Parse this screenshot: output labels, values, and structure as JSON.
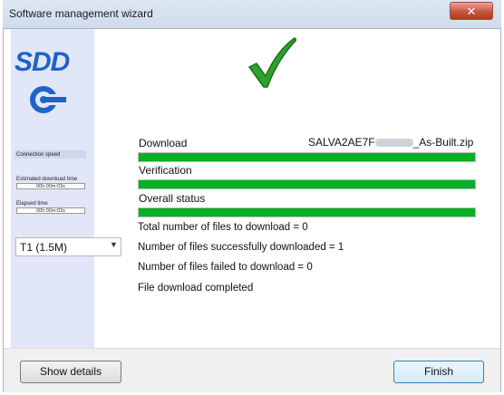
{
  "window": {
    "title": "Software management wizard",
    "close_glyph": "✕"
  },
  "sidebar": {
    "brand": "SDD",
    "connection_speed_label": "Connection speed",
    "est_time_label": "Estimated download time",
    "est_time_value": "00h:00m:03s",
    "elapsed_label": "Elapsed time",
    "elapsed_value": "00h:00m:02s",
    "speed_select_value": "T1 (1.5M)"
  },
  "main": {
    "status_icon": "checkmark-icon",
    "download_label": "Download",
    "file_name_prefix": "SALVA2AE7F",
    "file_name_suffix": "_As-Built.zip",
    "download_progress": 1.0,
    "verification_label": "Verification",
    "verification_progress": 1.0,
    "overall_label": "Overall status",
    "overall_progress": 1.0,
    "total_files": "Total number of files to download = 0",
    "success_files": "Number of files successfully downloaded = 1",
    "failed_files": "Number of files failed to download = 0",
    "completion_message": "File download completed"
  },
  "footer": {
    "show_details": "Show details",
    "finish": "Finish"
  },
  "colors": {
    "progress_fill": "#06b025",
    "panel": "#e1e6f8",
    "brand": "#1e63c7",
    "check": "#2fa32b"
  }
}
